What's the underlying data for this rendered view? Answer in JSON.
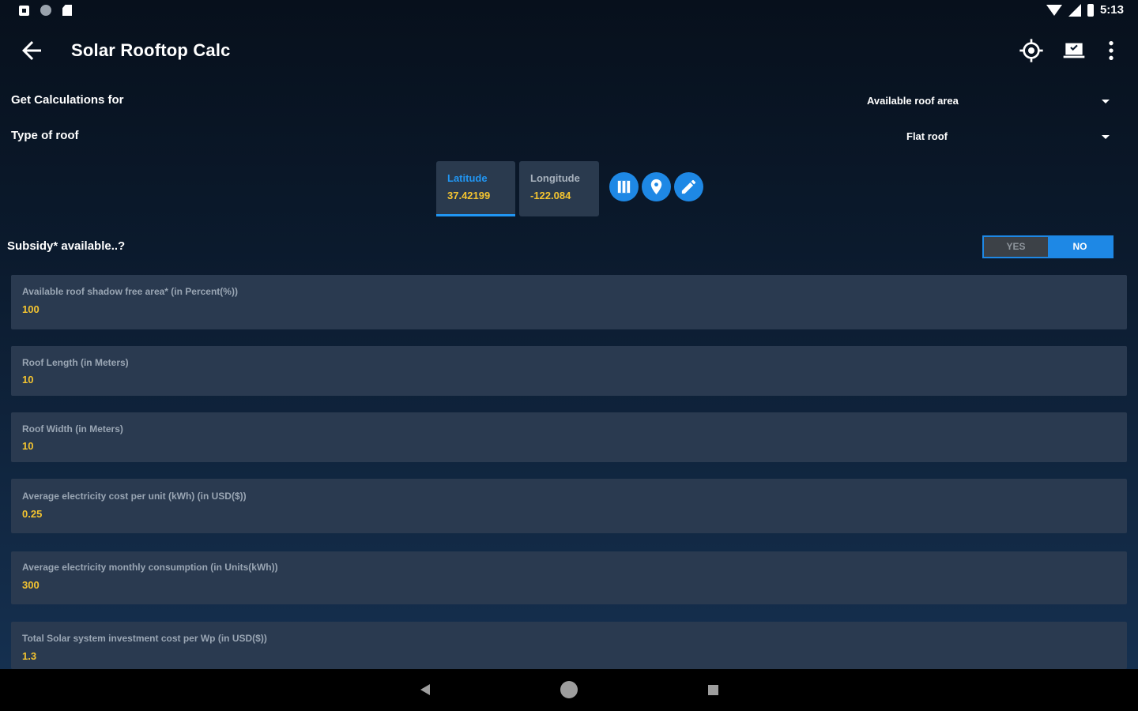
{
  "status_bar": {
    "time": "5:13"
  },
  "app_bar": {
    "title": "Solar Rooftop Calc"
  },
  "settings": {
    "calc_for": {
      "label": "Get Calculations for",
      "value": "Available roof area"
    },
    "roof_type": {
      "label": "Type of roof",
      "value": "Flat roof"
    }
  },
  "coordinates": {
    "latitude": {
      "label": "Latitude",
      "value": "37.42199"
    },
    "longitude": {
      "label": "Longitude",
      "value": "-122.084"
    }
  },
  "subsidy": {
    "label": "Subsidy* available..?",
    "yes_label": "YES",
    "no_label": "NO",
    "selected": "NO"
  },
  "fields": [
    {
      "label": "Available roof shadow free area* (in Percent(%))",
      "value": "100"
    },
    {
      "label": "Roof Length (in Meters)",
      "value": "10"
    },
    {
      "label": "Roof Width (in Meters)",
      "value": "10"
    },
    {
      "label": "Average electricity cost per unit (kWh) (in USD($))",
      "value": "0.25"
    },
    {
      "label": "Average electricity monthly consumption (in Units(kWh))",
      "value": "300"
    },
    {
      "label": "Total Solar system investment cost per Wp (in USD($))",
      "value": "1.3"
    }
  ],
  "colors": {
    "accent": "#1e88e5",
    "value_text": "#f4c430",
    "card_bg": "#2a3a50"
  }
}
